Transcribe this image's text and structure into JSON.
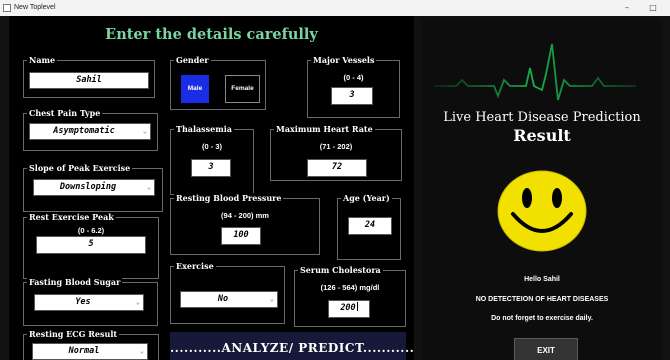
{
  "window": {
    "title": "New Toplevel",
    "minimize_glyph": "–",
    "maximize_glyph": "□"
  },
  "form": {
    "heading": "Enter the details carefully",
    "name": {
      "label": "Name",
      "value": "Sahil"
    },
    "chest_pain": {
      "label": "Chest Pain Type",
      "value": "Asymptomatic"
    },
    "slope": {
      "label": "Slope of Peak Exercise",
      "value": "Downsloping"
    },
    "rest_peak": {
      "label": "Rest Exercise Peak",
      "range": "(0 - 6.2)",
      "value": "5"
    },
    "fasting": {
      "label": "Fasting Blood Sugar",
      "value": "Yes"
    },
    "ecg": {
      "label": "Resting ECG Result",
      "value": "Normal"
    },
    "gender": {
      "label": "Gender",
      "male": "Male",
      "female": "Female",
      "selected": "Male"
    },
    "vessels": {
      "label": "Major Vessels",
      "range": "(0 - 4)",
      "value": "3"
    },
    "thal": {
      "label": "Thalassemia",
      "range": "(0 - 3)",
      "value": "3"
    },
    "heart_rate": {
      "label": "Maximum Heart Rate",
      "range": "(71 - 202)",
      "value": "72"
    },
    "bp": {
      "label": "Resting Blood Pressure",
      "range": "(94 - 200) mm",
      "value": "100"
    },
    "age": {
      "label": "Age (Year)",
      "value": "24"
    },
    "exercise": {
      "label": "Exercise",
      "value": "No"
    },
    "chol": {
      "label": "Serum Cholestora",
      "range": "(126 - 564) mg/dl",
      "value": "200"
    },
    "analyze_label": "...........ANALYZE/ PREDICT..........."
  },
  "result": {
    "title": "Live Heart Disease Prediction",
    "subtitle": "Result",
    "greeting": "Hello Sahil",
    "verdict": "NO DETECTEION OF HEART DISEASES",
    "advice": "Do not forget to exercise daily.",
    "exit_label": "EXIT"
  },
  "colors": {
    "heading": "#79d6a0",
    "male_button": "#1a2de6",
    "ecg_line": "#17b04c",
    "analyze_bg": "#17193a",
    "smiley_face": "#f2e100"
  },
  "icons": {
    "app_icon": "window-icon",
    "dropdown": "chevron-down-icon",
    "smiley": "smiley-face-icon",
    "heartbeat": "ecg-heartbeat-icon"
  }
}
